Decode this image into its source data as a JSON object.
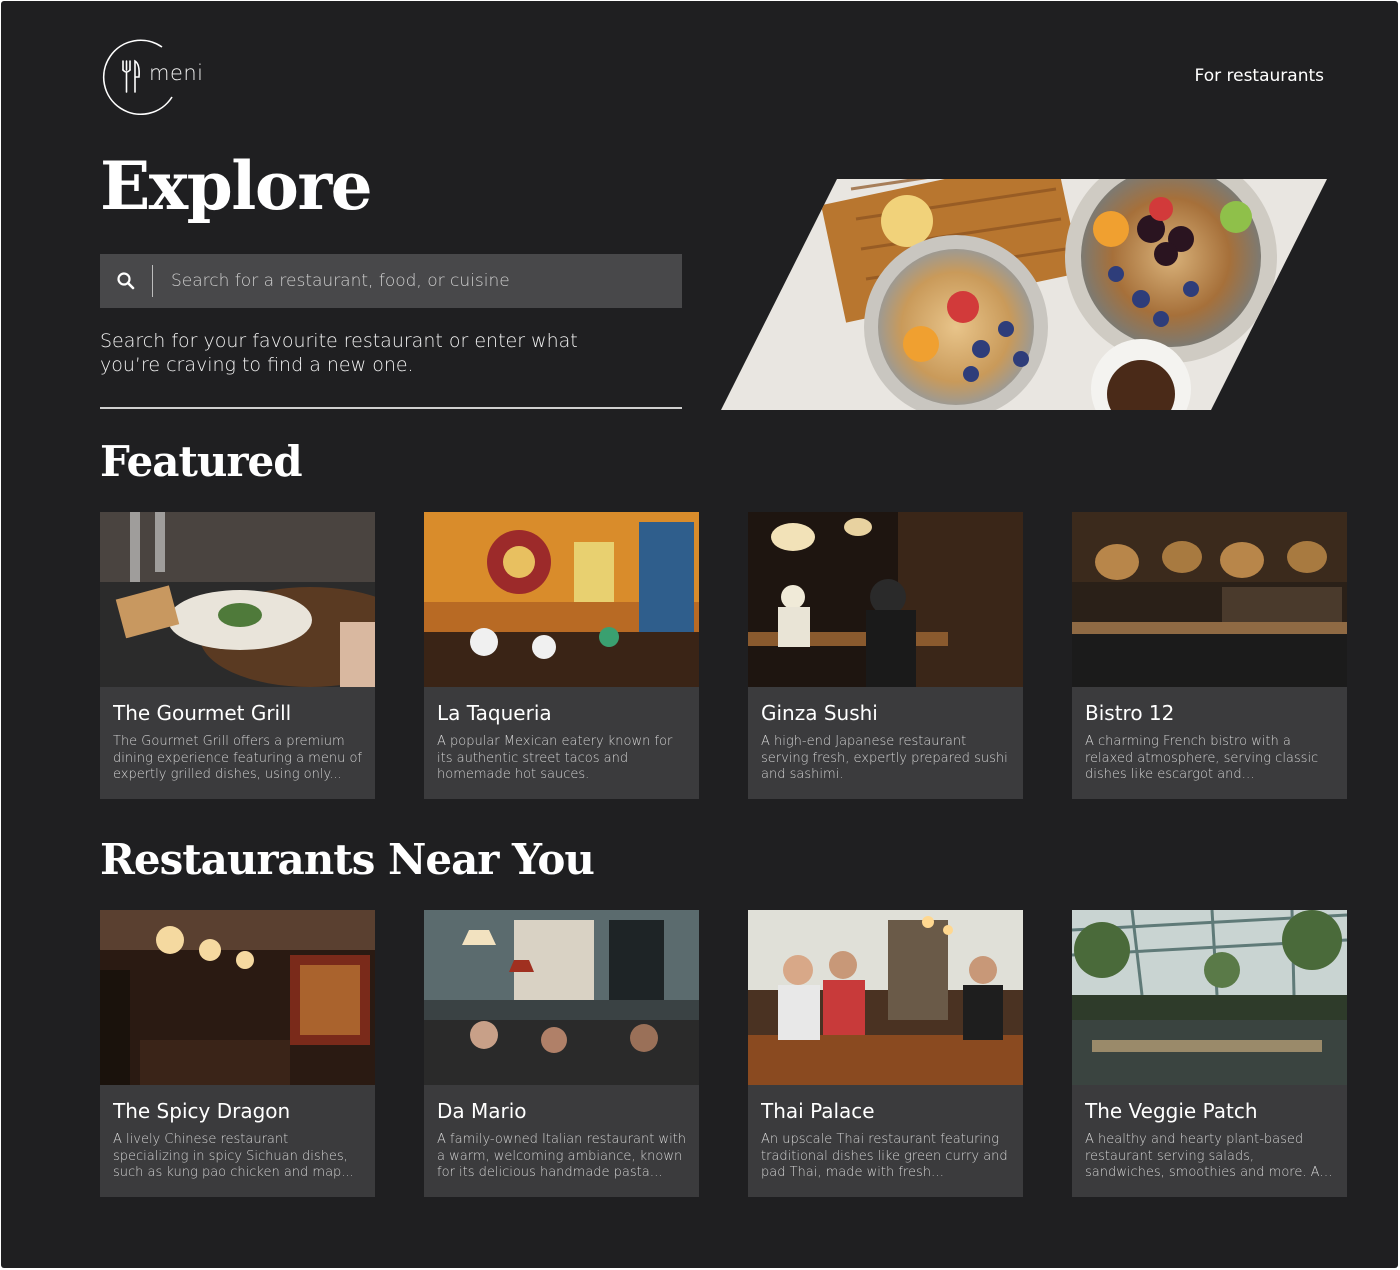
{
  "brand": {
    "name": "meni",
    "logo_icon": "fork-knife-icon"
  },
  "nav": {
    "for_restaurants": "For restaurants"
  },
  "hero": {
    "title": "Explore",
    "search_placeholder": "Search for a restaurant, food, or cuisine",
    "search_icon": "search-icon",
    "description": "Search for your favourite restaurant or enter what you’re craving to find a new one.",
    "image": "breakfast-bowls-photo"
  },
  "featured": {
    "title": "Featured",
    "items": [
      {
        "name": "The Gourmet Grill",
        "description": "The Gourmet Grill offers a premium dining experience featuring a menu of expertly grilled dishes, using only...",
        "image": "fine-dining-plate-photo",
        "palette": [
          "#e9e4da",
          "#6b4a2e",
          "#2b2b2b"
        ]
      },
      {
        "name": "La Taqueria",
        "description": "A popular Mexican eatery known for its authentic street tacos and homemade hot sauces.",
        "image": "colorful-mexican-interior-photo",
        "palette": [
          "#d98c2b",
          "#2f5e8c",
          "#3a2416"
        ]
      },
      {
        "name": "Ginza Sushi",
        "description": "A high-end Japanese restaurant serving fresh, expertly prepared sushi and sashimi.",
        "image": "sushi-counter-photo",
        "palette": [
          "#2a1d14",
          "#8a5a2e",
          "#e8d2a0"
        ]
      },
      {
        "name": "Bistro 12",
        "description": "A charming French bistro with a relaxed atmosphere, serving classic dishes like escargot and bouillabaisse.",
        "image": "bistro-bar-photo",
        "palette": [
          "#3b2a1c",
          "#8f6a44",
          "#1b1b1b"
        ]
      }
    ]
  },
  "nearby": {
    "title": "Restaurants Near You",
    "items": [
      {
        "name": "The Spicy Dragon",
        "description": "A lively Chinese restaurant specializing in spicy Sichuan dishes, such as kung pao chicken and map...",
        "image": "chandelier-dining-room-photo",
        "palette": [
          "#2a1a12",
          "#c98a3a",
          "#7a2a1a"
        ]
      },
      {
        "name": "Da Mario",
        "description": "A family-owned Italian restaurant with a warm, welcoming ambiance, known for its delicious handmade pasta and...",
        "image": "busy-cafe-photo",
        "palette": [
          "#5b6b6e",
          "#d9d2c4",
          "#2a2a2a"
        ]
      },
      {
        "name": "Thai Palace",
        "description": "An upscale Thai restaurant featuring traditional dishes like green curry and pad Thai, made with fresh ingredient...",
        "image": "bar-counter-friends-photo",
        "palette": [
          "#4a3222",
          "#d7b07a",
          "#e0e0d8"
        ]
      },
      {
        "name": "The Veggie Patch",
        "description": "A healthy and hearty plant-based restaurant serving salads, sandwiches, smoothies and more. All ingredients",
        "image": "greenhouse-restaurant-photo",
        "palette": [
          "#5f7a78",
          "#2e3b2a",
          "#c9d4d2"
        ]
      }
    ]
  }
}
